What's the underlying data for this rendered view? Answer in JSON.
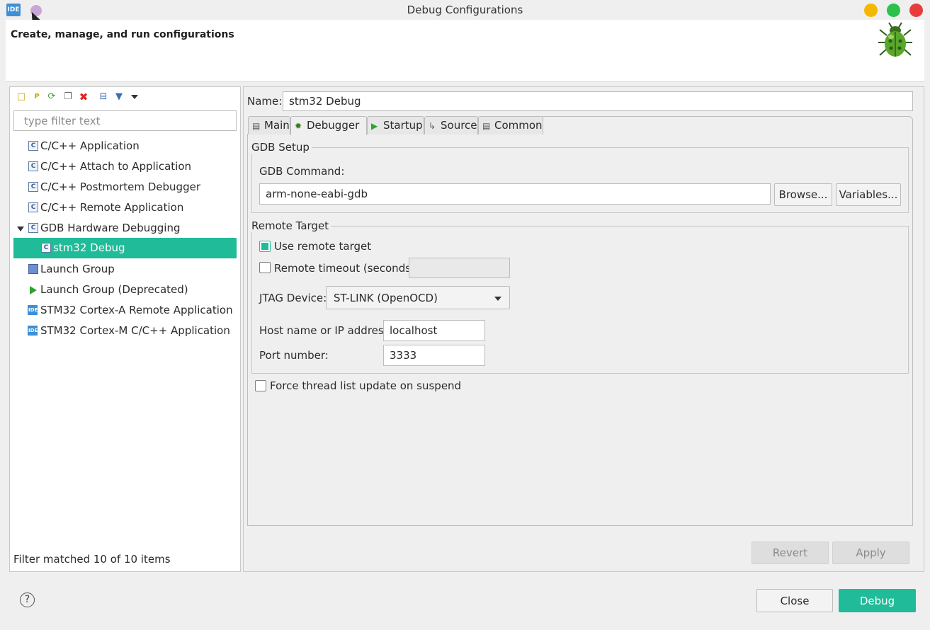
{
  "window": {
    "title": "Debug Configurations",
    "app_icon_text": "IDE"
  },
  "header": {
    "text": "Create, manage, and run configurations"
  },
  "left_panel": {
    "toolbar": [
      "new-config-icon",
      "new-prototype-icon",
      "export-icon",
      "duplicate-icon",
      "delete-icon",
      "collapse-all-icon",
      "filter-icon",
      "view-menu-icon"
    ],
    "filter_placeholder": "type filter text",
    "tree": [
      {
        "label": "C/C++ Application",
        "icon": "c-config-icon"
      },
      {
        "label": "C/C++ Attach to Application",
        "icon": "c-config-icon"
      },
      {
        "label": "C/C++ Postmortem Debugger",
        "icon": "c-config-icon"
      },
      {
        "label": "C/C++ Remote Application",
        "icon": "c-config-icon"
      },
      {
        "label": "GDB Hardware Debugging",
        "icon": "c-config-icon",
        "expanded": true
      },
      {
        "label": "stm32 Debug",
        "icon": "c-config-icon",
        "selected": true,
        "child": true
      },
      {
        "label": "Launch Group",
        "icon": "launch-group-icon"
      },
      {
        "label": "Launch Group (Deprecated)",
        "icon": "run-icon"
      },
      {
        "label": "STM32 Cortex-A Remote Application",
        "icon": "ide-icon"
      },
      {
        "label": "STM32 Cortex-M C/C++ Application",
        "icon": "ide-icon"
      }
    ],
    "status": "Filter matched 10 of 10 items"
  },
  "right_panel": {
    "name_label": "Name:",
    "name_value": "stm32 Debug",
    "tabs": [
      {
        "label": "Main",
        "icon": "main-tab-icon"
      },
      {
        "label": "Debugger",
        "icon": "bug-tab-icon",
        "active": true
      },
      {
        "label": "Startup",
        "icon": "run-icon"
      },
      {
        "label": "Source",
        "icon": "source-tab-icon"
      },
      {
        "label": "Common",
        "icon": "common-tab-icon"
      }
    ],
    "gdb_setup": {
      "title": "GDB Setup",
      "command_label": "GDB Command:",
      "command_value": "arm-none-eabi-gdb",
      "browse_label": "Browse...",
      "variables_label": "Variables..."
    },
    "remote_target": {
      "title": "Remote Target",
      "use_remote_label": "Use remote target",
      "use_remote_checked": true,
      "timeout_label": "Remote timeout (seconds):",
      "timeout_checked": false,
      "timeout_value": "",
      "jtag_label": "JTAG Device:",
      "jtag_value": "ST-LINK (OpenOCD)",
      "host_label": "Host name or IP address:",
      "host_value": "localhost",
      "port_label": "Port number:",
      "port_value": "3333"
    },
    "force_thread_label": "Force thread list update on suspend",
    "force_thread_checked": false,
    "revert_label": "Revert",
    "apply_label": "Apply"
  },
  "footer": {
    "help_icon_text": "?",
    "close_label": "Close",
    "debug_label": "Debug"
  },
  "colors": {
    "accent": "#20bb98",
    "minimize": "#f5b800",
    "maximize": "#2cc04d",
    "close": "#ea3b3b"
  }
}
